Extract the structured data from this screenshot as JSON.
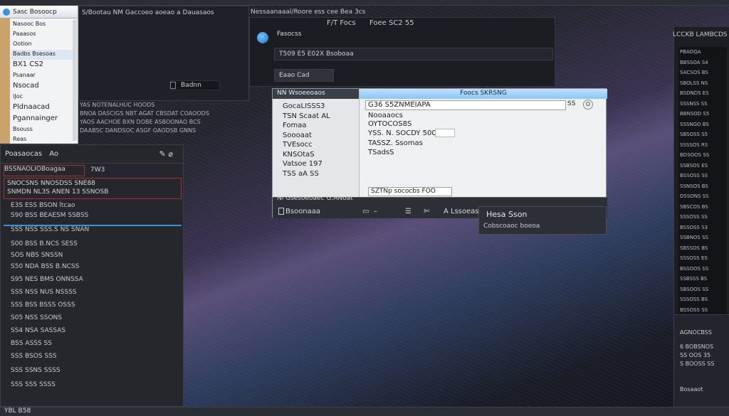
{
  "left_menu": {
    "header": "Sasc Bosoocp",
    "items": [
      "Nasooc Bos",
      "Paaasos",
      "Ootion",
      "Badbs Bsesoas",
      "BX1 CS2",
      "Psanaar",
      "Nsocad",
      "lJoc",
      "Pldnaacad",
      "Pgannainger",
      "Bsouss",
      "Reas"
    ]
  },
  "top_window": {
    "title": "S/Bootau NM Gaccoeo aoeao a  Dauasaos",
    "field": "Badnn"
  },
  "caption_lines": [
    "YAS NOTENALHUC HOODS",
    "BNOA DASCIGS NBT AGAT CBSDAT  COAOODS",
    "YAOS AACHOE BXN DOBE ASBOONAO BCS",
    "DAABSC DANDSOC ASGF OAODSB GNNS"
  ],
  "top_title": "Nessaanaaal/Roore ess cee Bea 3cs",
  "top_area": {
    "tab_active": "Fasocss",
    "tab2": "F/T Focs",
    "tab3": "Foee SC2 55",
    "row1": "T509 E5 E02X  Bsoboaa",
    "row2": "Eaao Cad"
  },
  "dialog": {
    "left_header": "NN Wsoeeoaos",
    "left_items": [
      "GocaLISSS3",
      "TSN Scaat AL",
      "Fomaa",
      "Soooaat",
      "TVEsocc",
      "KNSOtaS",
      "Vatsoe 197",
      "TSS aA SS"
    ],
    "right_header": "Foocs SKRSNG",
    "field": "G36 S5ZNMEIAPA",
    "field_btn": "SS",
    "circle_btn": "O",
    "right_items": [
      "Nooaaocs",
      "OYTOCOS8S",
      "YSS. N. SOCDY 500",
      "TASSZ. Ssomas",
      "TSadsS"
    ],
    "input": "SZTNp sococbs FOO",
    "footer_top": "Nl Gsesoeoaec G.ANoat",
    "footer_btn": "Bsoonaaa",
    "footer_right": "A Lssoeas"
  },
  "help_popup": {
    "title": "Hesa Sson",
    "subtitle": "Cobscoaoc boeoa"
  },
  "list_panel": {
    "title": "Poasaocas",
    "a": "Ao",
    "row_a": "BSSNAOLIOBoagaa",
    "row_a_right": "7W3",
    "row_b": "SNOCSNS NNOSDSS SNE88",
    "row_c": "SNMDN NL3S ANEN 13 SSNOSB",
    "rows": [
      "E3S  ESS  BSON ltcao",
      "S90  BSS  BEAESM SSBSS",
      "SSS  NSS  SSS.S NS SNAN",
      "S00  BSS  B.NCS SESS",
      "SOS  NBS  SNSSN",
      "S50  NDA  BSS  B.NCSS",
      "S95  NES  BMS  ONNSSA",
      "SSS  NSS  NUS  NSSSS",
      "SSS  BSS  BSSS OSSS",
      "S05  NSS  SSONS",
      "SS4  NSA  SASSAS",
      "BSS  ASSS SS",
      "SSS  BSOS SSS",
      "SSS  SSNS SSSS",
      "SSS  SSS  SSSS"
    ]
  },
  "right_panel": {
    "title": "LCCKB LAMBCDS",
    "list": [
      "PBADQA",
      "BBSSOA S4",
      "SACSOS BS",
      "SBOLSS NS",
      "BSDNDS ES",
      "SSSNSS SS",
      "BBNSOD S5",
      "SSSNGO BS",
      "SBSOSS S5",
      "SSSSOS RS",
      "BDSOOS SS",
      "SSBSOS ES",
      "BSSOSS SS",
      "SSNSOS BS",
      "DSSONS SS",
      "SBSCOS BS",
      "SSSOSS SS",
      "BSSOSS S3",
      "SSBNOS SS",
      "SBSSOS BS",
      "SSSOSS ES",
      "BSSOOS SS",
      "SSBSSS BS",
      "SBSOOS SS",
      "SSSOSS BS",
      "BSSOSS SS"
    ],
    "sec_title": "AGNOCBSS",
    "sec_lines": [
      "6 BOBSNOS",
      "SS OOS 35",
      "S BOOSS SS"
    ],
    "sec_bottom": "Bosaaot"
  },
  "status_bar": {
    "label": "YBL B58"
  }
}
